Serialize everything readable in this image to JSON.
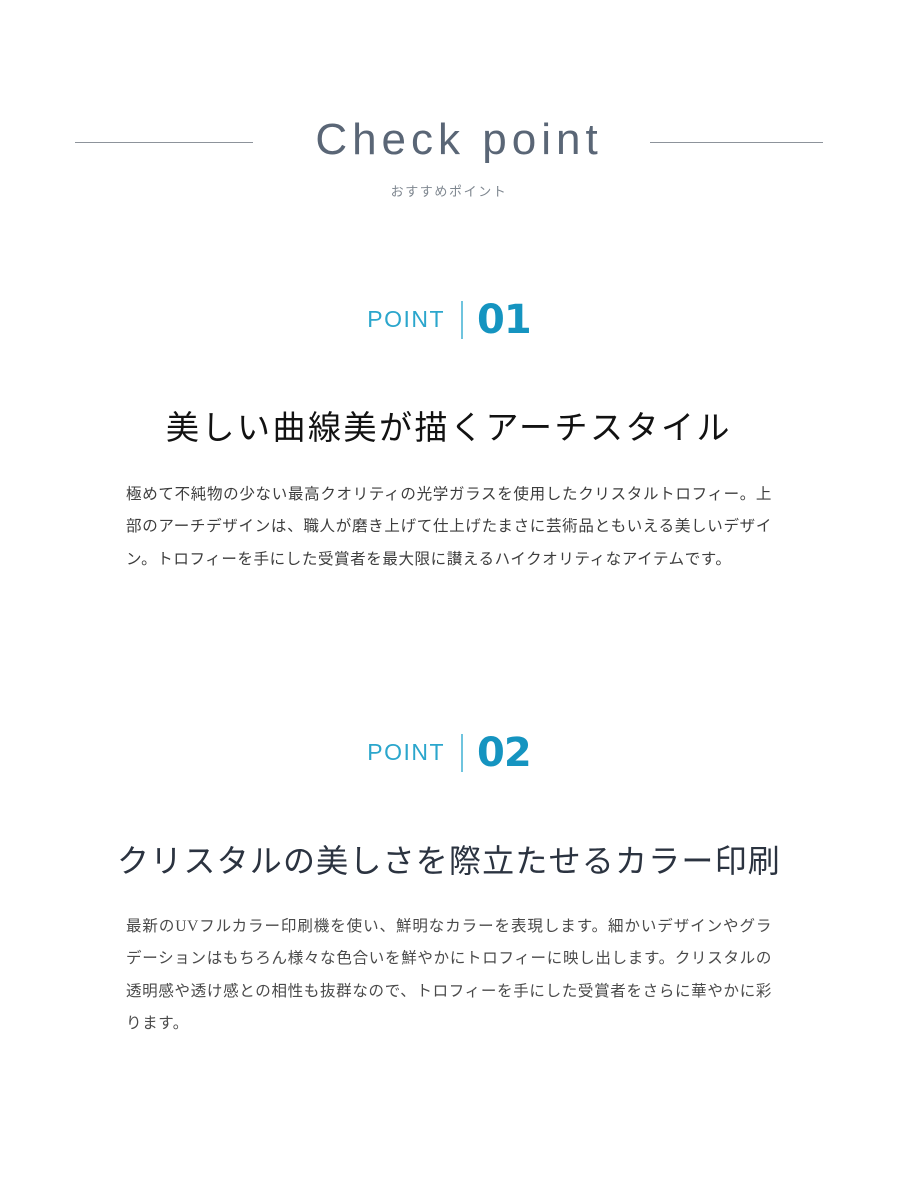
{
  "header": {
    "title": "Check point",
    "subtitle": "おすすめポイント"
  },
  "points": [
    {
      "label": "POINT",
      "number": "01",
      "heading": "美しい曲線美が描くアーチスタイル",
      "body": "極めて不純物の少ない最高クオリティの光学ガラスを使用したクリスタルトロフィー。上部のアーチデザインは、職人が磨き上げて仕上げたまさに芸術品ともいえる美しいデザイン。トロフィーを手にした受賞者を最大限に讃えるハイクオリティなアイテムです。"
    },
    {
      "label": "POINT",
      "number": "02",
      "heading": "クリスタルの美しさを際立たせるカラー印刷",
      "body": "最新のUVフルカラー印刷機を使い、鮮明なカラーを表現します。細かいデザインやグラデーションはもちろん様々な色合いを鮮やかにトロフィーに映し出します。クリスタルの透明感や透け感との相性も抜群なので、トロフィーを手にした受賞者をさらに華やかに彩ります。"
    }
  ],
  "colors": {
    "accent": "#1594c0",
    "accent_light": "#2ba6cc",
    "divider": "#6fc4de",
    "rule": "#8d939b",
    "title": "#5a6676",
    "subtitle": "#7e868f",
    "heading": "#121212",
    "heading_alt": "#2b3340",
    "body": "#3d3d3d",
    "background": "#ffffff"
  }
}
